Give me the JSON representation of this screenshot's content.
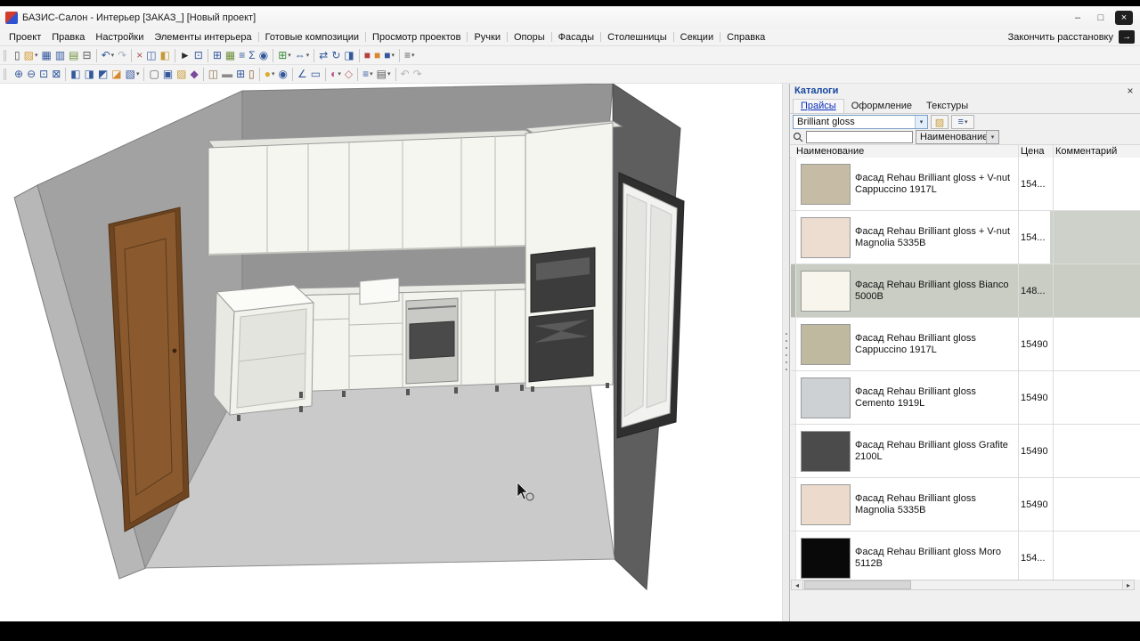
{
  "window": {
    "title": "БАЗИС-Салон - Интерьер [ЗАКАЗ_] [Новый проект]",
    "min_glyph": "–",
    "max_glyph": "□",
    "close_glyph": "×"
  },
  "ui": {
    "caret": "▾",
    "scroll_left": "◂",
    "scroll_right": "▸"
  },
  "menu": {
    "items": [
      {
        "label": "Проект"
      },
      {
        "label": "Правка"
      },
      {
        "label": "Настройки"
      },
      {
        "label": "Элементы интерьера",
        "divider": true
      },
      {
        "label": "Готовые композиции",
        "divider": true
      },
      {
        "label": "Просмотр проектов",
        "divider": true
      },
      {
        "label": "Ручки",
        "divider": true
      },
      {
        "label": "Опоры",
        "divider": true
      },
      {
        "label": "Фасады",
        "divider": true
      },
      {
        "label": "Столешницы",
        "divider": true
      },
      {
        "label": "Секции",
        "divider": true
      },
      {
        "label": "Справка"
      }
    ],
    "finish_label": "Закончить расстановку",
    "exit_glyph": "→"
  },
  "toolbar1": {
    "items": [
      {
        "name": "new-document",
        "glyph": "▯",
        "color": "#4a4a4a"
      },
      {
        "name": "open-project",
        "glyph": "▨",
        "color": "#d49a2e",
        "caret": true
      },
      {
        "name": "save",
        "glyph": "▦",
        "color": "#33589c"
      },
      {
        "name": "save-all",
        "glyph": "▥",
        "color": "#33589c"
      },
      {
        "name": "import-model",
        "glyph": "▤",
        "color": "#6f8f3c"
      },
      {
        "name": "print",
        "glyph": "⊟",
        "color": "#5a5a5a"
      },
      {
        "sep": true
      },
      {
        "name": "undo",
        "glyph": "↶",
        "color": "#33589c",
        "caret": true
      },
      {
        "name": "redo",
        "glyph": "↷",
        "color": "#a9b2c2"
      },
      {
        "sep": true
      },
      {
        "name": "delete-element",
        "glyph": "×",
        "color": "#b24a4a"
      },
      {
        "name": "copy",
        "glyph": "◫",
        "color": "#33589c"
      },
      {
        "name": "paste",
        "glyph": "◧",
        "color": "#c79a35"
      },
      {
        "sep": true
      },
      {
        "name": "select-pointer",
        "glyph": "►",
        "color": "#2b2b2b"
      },
      {
        "name": "select-region",
        "glyph": "⊡",
        "color": "#33589c"
      },
      {
        "sep": true
      },
      {
        "name": "grid",
        "glyph": "⊞",
        "color": "#33589c"
      },
      {
        "name": "table-view",
        "glyph": "▦",
        "color": "#6f8f3c"
      },
      {
        "name": "layers",
        "glyph": "≡",
        "color": "#33589c"
      },
      {
        "name": "sum-estimate",
        "glyph": "Σ",
        "color": "#33589c"
      },
      {
        "name": "preview-eye",
        "glyph": "◉",
        "color": "#33589c"
      },
      {
        "sep": true
      },
      {
        "name": "add-element",
        "glyph": "⊞",
        "color": "#3c8a3c",
        "caret": true
      },
      {
        "name": "dimensions",
        "glyph": "⇔",
        "color": "#33589c",
        "caret": true
      },
      {
        "sep": true
      },
      {
        "name": "move-object",
        "glyph": "⇄",
        "color": "#33589c"
      },
      {
        "name": "rotate-object",
        "glyph": "↻",
        "color": "#33589c"
      },
      {
        "name": "mirror-object",
        "glyph": "◨",
        "color": "#33589c"
      },
      {
        "sep": true
      },
      {
        "name": "material-red",
        "glyph": "■",
        "color": "#b44040"
      },
      {
        "name": "material-orange",
        "glyph": "■",
        "color": "#d4892e"
      },
      {
        "name": "material-blue",
        "glyph": "■",
        "color": "#33589c",
        "caret": true
      },
      {
        "sep": true
      },
      {
        "name": "settings-list",
        "glyph": "≡",
        "color": "#5a5a5a",
        "caret": true
      }
    ]
  },
  "toolbar2": {
    "items": [
      {
        "name": "zoom-in",
        "glyph": "⊕",
        "color": "#33589c"
      },
      {
        "name": "zoom-out",
        "glyph": "⊖",
        "color": "#33589c"
      },
      {
        "name": "zoom-window",
        "glyph": "⊡",
        "color": "#33589c"
      },
      {
        "name": "zoom-all",
        "glyph": "⊠",
        "color": "#33589c"
      },
      {
        "sep": true
      },
      {
        "name": "view-front",
        "glyph": "◧",
        "color": "#33589c"
      },
      {
        "name": "view-side",
        "glyph": "◨",
        "color": "#33589c"
      },
      {
        "name": "view-top",
        "glyph": "◩",
        "color": "#33589c"
      },
      {
        "name": "view-iso",
        "glyph": "◪",
        "color": "#d4892e"
      },
      {
        "name": "view-perspective",
        "glyph": "▧",
        "color": "#33589c",
        "caret": true
      },
      {
        "sep": true
      },
      {
        "name": "wireframe-mode",
        "glyph": "▢",
        "color": "#5a5a5a"
      },
      {
        "name": "shaded-mode",
        "glyph": "▣",
        "color": "#33589c"
      },
      {
        "name": "textured-mode",
        "glyph": "▨",
        "color": "#c79a35"
      },
      {
        "name": "render-scene",
        "glyph": "◆",
        "color": "#7a4a9c"
      },
      {
        "sep": true
      },
      {
        "name": "walls-tool",
        "glyph": "◫",
        "color": "#8a6f4a"
      },
      {
        "name": "floor-tool",
        "glyph": "▬",
        "color": "#8a8a8a"
      },
      {
        "name": "window-tool",
        "glyph": "⊞",
        "color": "#33589c"
      },
      {
        "name": "door-tool",
        "glyph": "▯",
        "color": "#8a5a2e"
      },
      {
        "sep": true
      },
      {
        "name": "light-tool",
        "glyph": "●",
        "color": "#dcaa2e",
        "caret": true
      },
      {
        "name": "camera-tool",
        "glyph": "◉",
        "color": "#33589c"
      },
      {
        "sep": true
      },
      {
        "name": "measure-tool",
        "glyph": "∠",
        "color": "#33589c"
      },
      {
        "name": "ruler-tool",
        "glyph": "▭",
        "color": "#33589c"
      },
      {
        "sep": true
      },
      {
        "name": "texture-palette",
        "glyph": "◐",
        "color": "#b2508a",
        "caret": true
      },
      {
        "name": "eraser-tool",
        "glyph": "◇",
        "color": "#c46a6a"
      },
      {
        "sep": true
      },
      {
        "name": "panels-list",
        "glyph": "≡",
        "color": "#33589c",
        "caret": true
      },
      {
        "name": "notes-tool",
        "glyph": "▤",
        "color": "#5a5a5a",
        "caret": true
      },
      {
        "sep": true
      },
      {
        "name": "undo-view",
        "glyph": "↶",
        "color": "#b5b5b5"
      },
      {
        "name": "redo-view",
        "glyph": "↷",
        "color": "#b5b5b5"
      }
    ]
  },
  "catalog": {
    "title": "Каталоги",
    "close_glyph": "×",
    "tabs": [
      {
        "label": "Прайсы",
        "selected": true
      },
      {
        "label": "Оформление"
      },
      {
        "label": "Текстуры"
      }
    ],
    "combo_value": "Brilliant gloss",
    "sort_value": "Наименование",
    "columns": [
      "Наименование",
      "Цена",
      "Комментарий"
    ],
    "rows": [
      {
        "name": "Фасад Rehau Brilliant gloss + V-nut Cappuccino 1917L",
        "price": "154...",
        "swatch": "#c6bca6"
      },
      {
        "name": "Фасад Rehau Brilliant gloss + V-nut Magnolia 5335B",
        "price": "154...",
        "swatch": "#eddcd0",
        "comment_bg": "#cdd1c9"
      },
      {
        "name": "Фасад Rehau Brilliant gloss Bianco 5000B",
        "price": "148...",
        "swatch": "#f7f5ec",
        "selected": true
      },
      {
        "name": "Фасад Rehau Brilliant gloss Cappuccino 1917L",
        "price": "15490",
        "swatch": "#bfb9a0"
      },
      {
        "name": "Фасад Rehau Brilliant gloss Cemento 1919L",
        "price": "15490",
        "swatch": "#cdd1d4"
      },
      {
        "name": "Фасад Rehau Brilliant gloss Grafite 2100L",
        "price": "15490",
        "swatch": "#4b4b4b"
      },
      {
        "name": "Фасад Rehau Brilliant gloss Magnolia 5335B",
        "price": "15490",
        "swatch": "#ecdacd"
      },
      {
        "name": "Фасад Rehau Brilliant gloss Moro 5112B",
        "price": "154...",
        "swatch": "#090909"
      }
    ]
  }
}
